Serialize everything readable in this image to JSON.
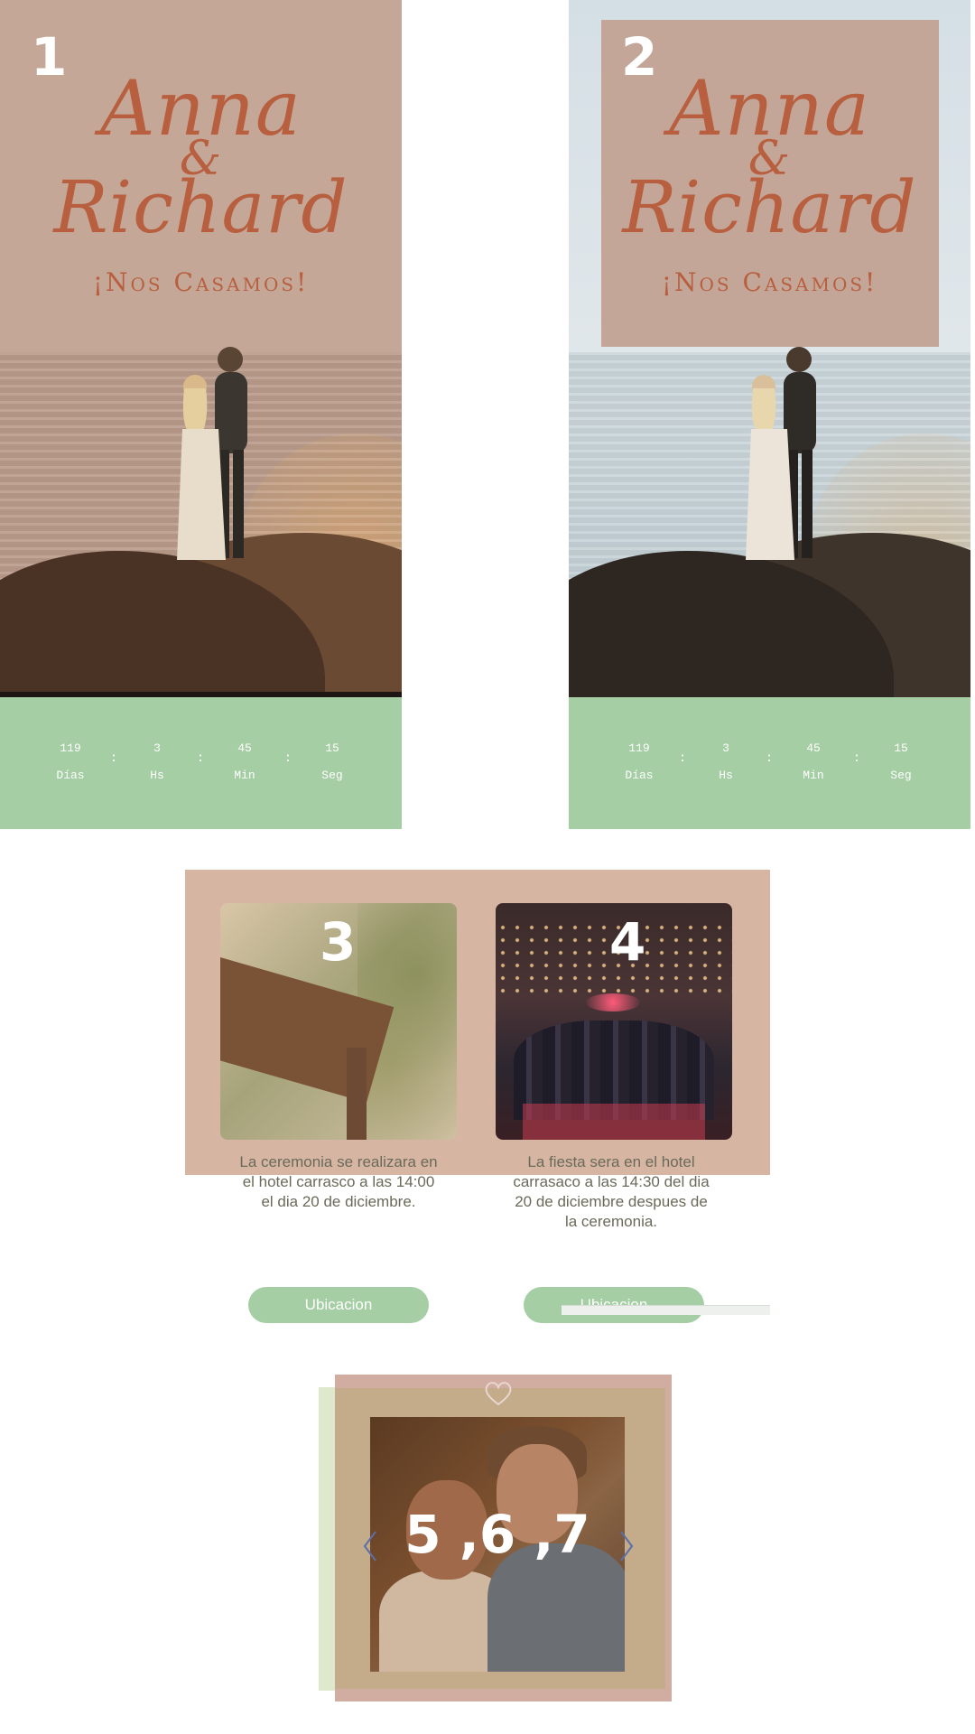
{
  "panels": [
    {
      "number": "1",
      "name_first": "Anna",
      "ampersand": "&",
      "name_second": "Richard",
      "tagline": "¡Nos Casamos!",
      "countdown": [
        {
          "value": "119",
          "label": "Días"
        },
        {
          "value": "3",
          "label": "Hs"
        },
        {
          "value": "45",
          "label": "Min"
        },
        {
          "value": "15",
          "label": "Seg"
        }
      ],
      "separator": ":"
    },
    {
      "number": "2",
      "name_first": "Anna",
      "ampersand": "&",
      "name_second": "Richard",
      "tagline": "¡Nos Casamos!",
      "countdown": [
        {
          "value": "119",
          "label": "Días"
        },
        {
          "value": "3",
          "label": "Hs"
        },
        {
          "value": "45",
          "label": "Min"
        },
        {
          "value": "15",
          "label": "Seg"
        }
      ],
      "separator": ":"
    }
  ],
  "events": [
    {
      "number": "3",
      "text": "La ceremonia se realizara en el hotel carrasco a las 14:00 el dia 20 de diciembre.",
      "button_label": "Ubicacion"
    },
    {
      "number": "4",
      "text": "La fiesta sera en el hotel carrasaco a las 14:30 del dia 20 de diciembre despues de la ceremonia.",
      "button_label": "Ubicacion"
    }
  ],
  "gallery": {
    "number": "5 ,6 ,7",
    "prev_icon": "chevron-left-icon",
    "next_icon": "chevron-right-icon",
    "decor_icon": "heart-icon"
  },
  "colors": {
    "accent_green": "#a5cea4",
    "name_terracotta": "#b85f3f",
    "panel_rose": "#c5a797",
    "events_rose": "#d6b5a3",
    "body_text": "#6b6a5a"
  }
}
